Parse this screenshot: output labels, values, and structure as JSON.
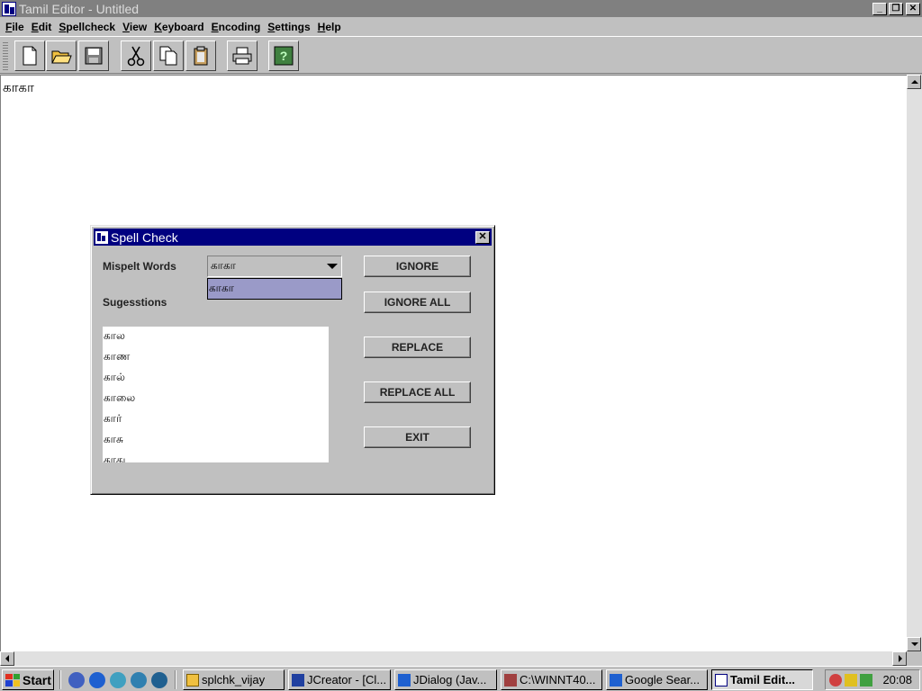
{
  "window": {
    "title": "Tamil Editor - Untitled"
  },
  "menu": [
    "File",
    "Edit",
    "Spellcheck",
    "View",
    "Keyboard",
    "Encoding",
    "Settings",
    "Help"
  ],
  "toolbar": {
    "icons": [
      "new-file-icon",
      "open-folder-icon",
      "save-icon",
      "cut-icon",
      "copy-icon",
      "paste-icon",
      "print-icon",
      "help-icon"
    ]
  },
  "document": {
    "text": "காகா"
  },
  "dialog": {
    "title": "Spell Check",
    "misspelt_label": "Mispelt Words",
    "misspelt_value": "காகா",
    "misspelt_options": [
      "காகா"
    ],
    "suggestions_label": "Sugesstions",
    "suggestions": [
      "கால",
      "காண",
      "கால்",
      "காலை",
      "கார்",
      "காசு",
      "காது"
    ],
    "buttons": {
      "ignore": "IGNORE",
      "ignore_all": "IGNORE ALL",
      "replace": "REPLACE",
      "replace_all": "REPLACE ALL",
      "exit": "EXIT"
    }
  },
  "taskbar": {
    "start": "Start",
    "tasks": [
      {
        "label": "splchk_vijay",
        "active": false
      },
      {
        "label": "JCreator - [Cl...",
        "active": false
      },
      {
        "label": "JDialog (Jav...",
        "active": false
      },
      {
        "label": "C:\\WINNT40...",
        "active": false
      },
      {
        "label": "Google Sear...",
        "active": false
      },
      {
        "label": "Tamil Edit...",
        "active": true
      }
    ],
    "clock": "20:08"
  }
}
